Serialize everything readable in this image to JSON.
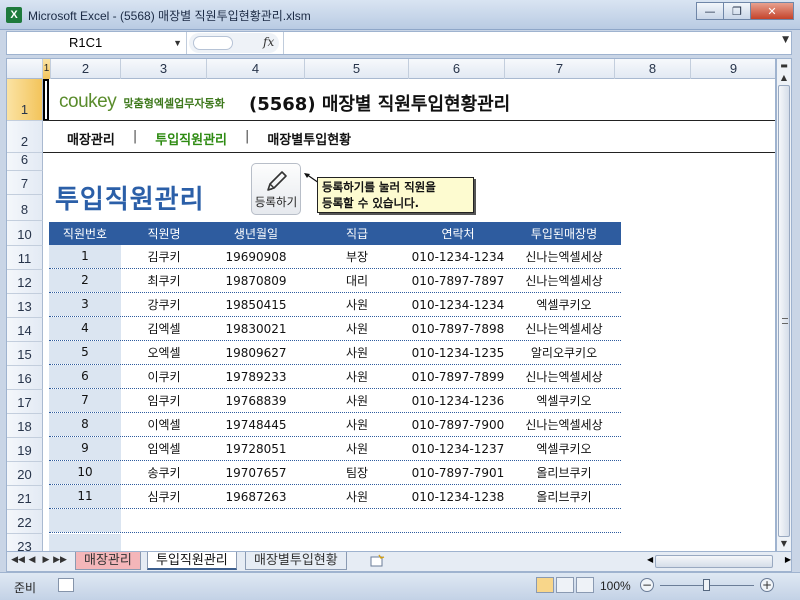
{
  "window": {
    "title": "Microsoft Excel - (5568) 매장별 직원투입현황관리.xlsm",
    "app_icon": "X",
    "minimize": "—",
    "restore": "❐",
    "close": "✕"
  },
  "formula_bar": {
    "name_box": "R1C1",
    "fx": "fx",
    "value": ""
  },
  "columns": [
    "1",
    "2",
    "3",
    "4",
    "5",
    "6",
    "7",
    "8",
    "9"
  ],
  "rows": [
    "1",
    "2",
    "6",
    "7",
    "8",
    "10",
    "11",
    "12",
    "13",
    "14",
    "15",
    "16",
    "17",
    "18",
    "19",
    "20",
    "21",
    "22",
    "23"
  ],
  "header": {
    "brand": "coukey",
    "brand_sub": "맞춤형엑셀업무자동화",
    "title": "(5568) 매장별 직원투입현황관리"
  },
  "nav": {
    "items": [
      "매장관리",
      "투입직원관리",
      "매장별투입현황"
    ],
    "separator": "|",
    "active_index": 1
  },
  "sheet": {
    "title": "투입직원관리",
    "register_button": "등록하기",
    "note_line1": "등록하기를 눌러 직원을",
    "note_line2": "등록할 수 있습니다."
  },
  "table": {
    "headers": [
      "직원번호",
      "직원명",
      "생년월일",
      "직급",
      "연락처",
      "투입된매장명"
    ],
    "rows": [
      [
        "1",
        "김쿠키",
        "19690908",
        "부장",
        "010-1234-1234",
        "신나는엑셀세상"
      ],
      [
        "2",
        "최쿠키",
        "19870809",
        "대리",
        "010-7897-7897",
        "신나는엑셀세상"
      ],
      [
        "3",
        "강쿠키",
        "19850415",
        "사원",
        "010-1234-1234",
        "엑셀쿠키오"
      ],
      [
        "4",
        "김엑셀",
        "19830021",
        "사원",
        "010-7897-7898",
        "신나는엑셀세상"
      ],
      [
        "5",
        "오엑셀",
        "19809627",
        "사원",
        "010-1234-1235",
        "알리오쿠키오"
      ],
      [
        "6",
        "이쿠키",
        "19789233",
        "사원",
        "010-7897-7899",
        "신나는엑셀세상"
      ],
      [
        "7",
        "임쿠키",
        "19768839",
        "사원",
        "010-1234-1236",
        "엑셀쿠키오"
      ],
      [
        "8",
        "이엑셀",
        "19748445",
        "사원",
        "010-7897-7900",
        "신나는엑셀세상"
      ],
      [
        "9",
        "임엑셀",
        "19728051",
        "사원",
        "010-1234-1237",
        "엑셀쿠키오"
      ],
      [
        "10",
        "송쿠키",
        "19707657",
        "팀장",
        "010-7897-7901",
        "올리브쿠키"
      ],
      [
        "11",
        "심쿠키",
        "19687263",
        "사원",
        "010-1234-1238",
        "올리브쿠키"
      ]
    ]
  },
  "tabs": {
    "nav": [
      "◀◀",
      "◀",
      "▶",
      "▶▶"
    ],
    "items": [
      "매장관리",
      "투입직원관리",
      "매장별투입현황"
    ],
    "active_index": 1
  },
  "status": {
    "ready": "준비",
    "zoom": "100%",
    "zoom_minus": "−",
    "zoom_plus": "+"
  },
  "colors": {
    "accent": "#2e5c9f",
    "title_blue": "#2b5fa8",
    "nav_active": "#2e8b12",
    "brand_green": "#5a8c2c",
    "tab1": "#f4b6b9"
  }
}
